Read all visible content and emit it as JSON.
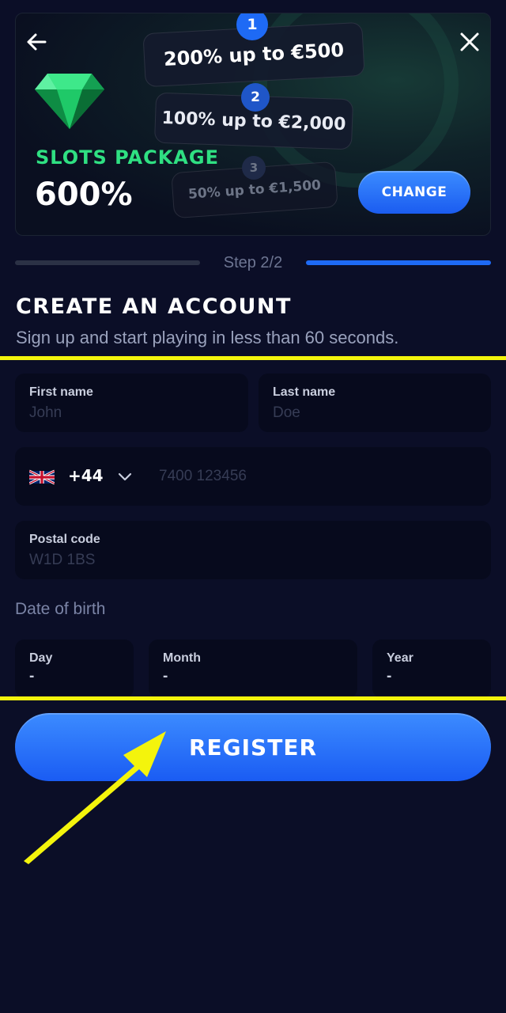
{
  "banner": {
    "offers": [
      {
        "step": "1",
        "text": "200% up to €500"
      },
      {
        "step": "2",
        "text": "100% up to €2,000"
      },
      {
        "step": "3",
        "text": "50% up to €1,500"
      }
    ],
    "package_label": "SLOTS PACKAGE",
    "package_percent": "600%",
    "change_label": "CHANGE"
  },
  "progress": {
    "label": "Step 2/2",
    "current_step": 2,
    "total_steps": 2
  },
  "header": {
    "title": "CREATE AN ACCOUNT",
    "subtitle": "Sign up and start playing in less than 60 seconds."
  },
  "form": {
    "first_name": {
      "label": "First name",
      "placeholder": "John"
    },
    "last_name": {
      "label": "Last name",
      "placeholder": "Doe"
    },
    "phone": {
      "country_flag": "uk-flag-icon",
      "dial_code": "+44",
      "placeholder": "7400 123456"
    },
    "postal_code": {
      "label": "Postal code",
      "placeholder": "W1D 1BS"
    },
    "dob": {
      "label": "Date of birth",
      "day": {
        "label": "Day",
        "value": "-"
      },
      "month": {
        "label": "Month",
        "value": "-"
      },
      "year": {
        "label": "Year",
        "value": "-"
      }
    },
    "register_label": "REGISTER"
  },
  "colors": {
    "background": "#0b0e27",
    "accent_blue": "#1e6af5",
    "package_green": "#2fe082",
    "highlight_yellow": "#f4f40c"
  }
}
